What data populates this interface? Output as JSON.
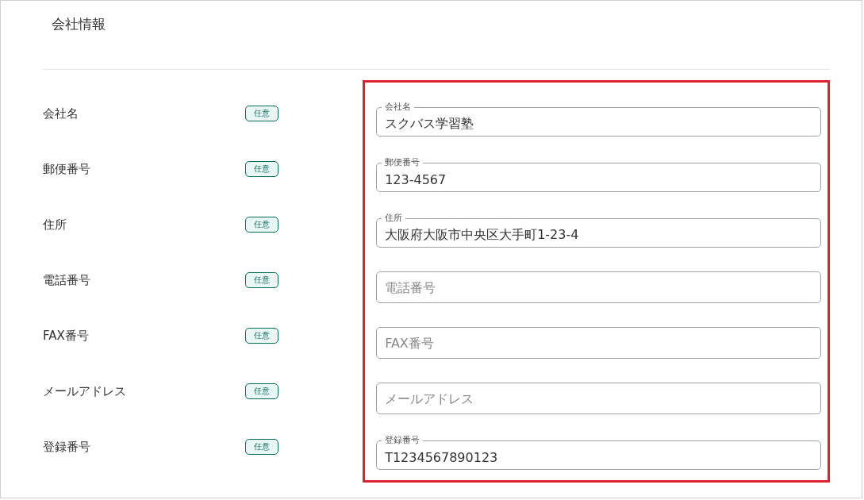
{
  "title": "会社情報",
  "rows": [
    {
      "label": "会社名",
      "badge": "任意",
      "field": {
        "label": "会社名",
        "value": "スクバス学習塾"
      }
    },
    {
      "label": "郵便番号",
      "badge": "任意",
      "field": {
        "label": "郵便番号",
        "value": "123-4567"
      }
    },
    {
      "label": "住所",
      "badge": "任意",
      "field": {
        "label": "住所",
        "value": "大阪府大阪市中央区大手町1-23-4"
      }
    },
    {
      "label": "電話番号",
      "badge": "任意",
      "field": {
        "placeholder": "電話番号"
      }
    },
    {
      "label": "FAX番号",
      "badge": "任意",
      "field": {
        "placeholder": "FAX番号"
      }
    },
    {
      "label": "メールアドレス",
      "badge": "任意",
      "field": {
        "placeholder": "メールアドレス"
      }
    },
    {
      "label": "登録番号",
      "badge": "任意",
      "field": {
        "label": "登録番号",
        "value": "T1234567890123"
      }
    }
  ]
}
